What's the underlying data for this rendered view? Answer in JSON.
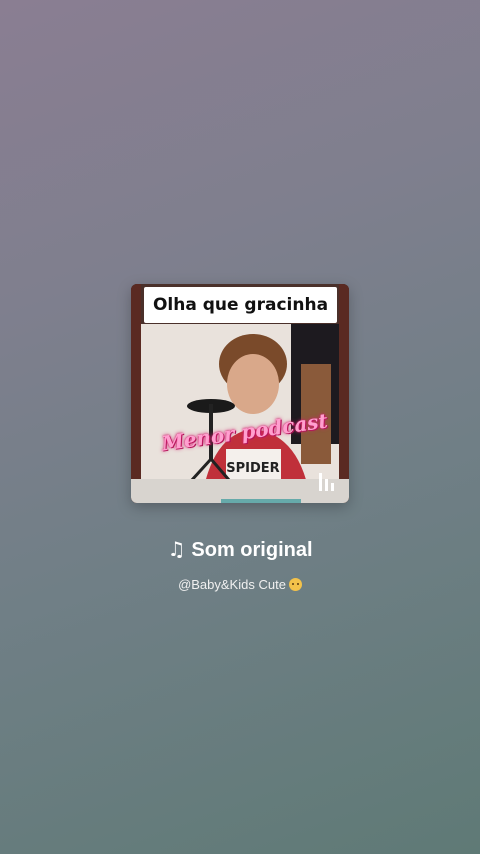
{
  "cover": {
    "caption": "Olha que gracinha",
    "overlay_text": "Menor podcast",
    "image_icon": "video-thumbnail",
    "playing_icon": "audio-bars-icon"
  },
  "sound": {
    "note_icon": "♫",
    "title": "Som original",
    "artist": "@Baby&Kids Cute",
    "artist_emoji_icon": "baby-face-icon"
  },
  "colors": {
    "background_top": "#8a7e92",
    "background_bottom": "#5f7a76",
    "text": "#ffffff",
    "overlay_pink": "#ff9fcf"
  }
}
